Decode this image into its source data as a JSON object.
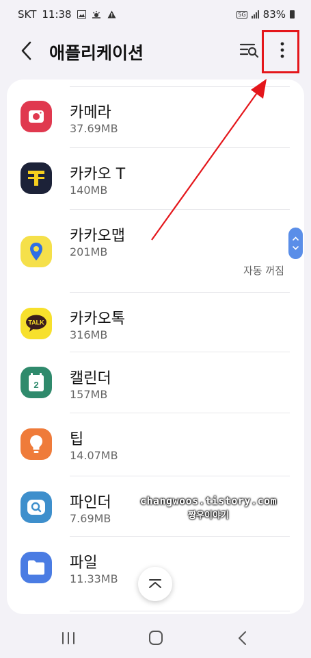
{
  "status_bar": {
    "carrier": "SKT",
    "time": "11:38",
    "network": "5G",
    "battery": "83%",
    "notification_icons": [
      "gallery-icon",
      "weather-icon",
      "alert-icon"
    ]
  },
  "header": {
    "title": "애플리케이션",
    "back_icon": "back-arrow-icon",
    "search_icon": "filter-search-icon",
    "more_icon": "more-options-icon"
  },
  "apps": [
    {
      "name": "카메라",
      "size": "37.69MB",
      "icon": "camera-icon",
      "color": "#e0394f"
    },
    {
      "name": "카카오 T",
      "size": "140MB",
      "icon": "kakao-t-icon",
      "color": "#1c2238"
    },
    {
      "name": "카카오맵",
      "size": "201MB",
      "icon": "kakaomap-icon",
      "color": "#f5e04a",
      "status": "자동 꺼짐"
    },
    {
      "name": "카카오톡",
      "size": "316MB",
      "icon": "kakaotalk-icon",
      "color": "#f7e02c",
      "badge": "TALK"
    },
    {
      "name": "캘린더",
      "size": "157MB",
      "icon": "calendar-icon",
      "color": "#2f8a6c",
      "badge": "2"
    },
    {
      "name": "팁",
      "size": "14.07MB",
      "icon": "tips-icon",
      "color": "#ef7b3a"
    },
    {
      "name": "파인더",
      "size": "7.69MB",
      "icon": "finder-icon",
      "color": "#3e8fcc"
    },
    {
      "name": "파일",
      "size": "11.33MB",
      "icon": "files-icon",
      "color": "#4a7ce3"
    }
  ],
  "watermark": {
    "url": "changwoos.tistory.com",
    "name": "짱우이야기"
  },
  "colors": {
    "highlight": "#e4161b",
    "scroll_handle": "#5a8ee8",
    "background": "#f3f2f7"
  },
  "nav_bar": [
    "recent-apps-icon",
    "home-icon",
    "back-icon"
  ]
}
